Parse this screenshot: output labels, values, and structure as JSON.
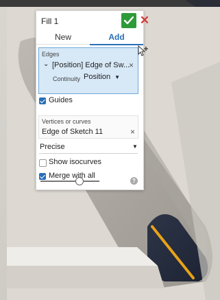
{
  "panel": {
    "title": "Fill 1",
    "ok_icon": "checkmark-icon",
    "cancel_icon": "close-icon",
    "tabs": [
      {
        "label": "New",
        "selected": false
      },
      {
        "label": "Add",
        "selected": true
      }
    ],
    "edges": {
      "label": "Edges",
      "item": "[Position] Edge of Sw...",
      "continuity_label": "Continuity",
      "continuity_value": "Position"
    },
    "guides": {
      "label": "Guides",
      "checked": true
    },
    "vertices": {
      "label": "Vertices or curves",
      "item": "Edge of Sketch 11"
    },
    "precision": "Precise",
    "show_isocurves": {
      "label": "Show isocurves",
      "checked": false
    },
    "merge_with_all": {
      "label": "Merge with all",
      "checked": true
    },
    "slider_level": 0.65
  },
  "colors": {
    "accent": "#2a6fb6",
    "ok": "#2e9b39",
    "cancel": "#d43b3b",
    "selection_fill": "#d7e8f7",
    "highlight_edge": "#e8a21a"
  }
}
